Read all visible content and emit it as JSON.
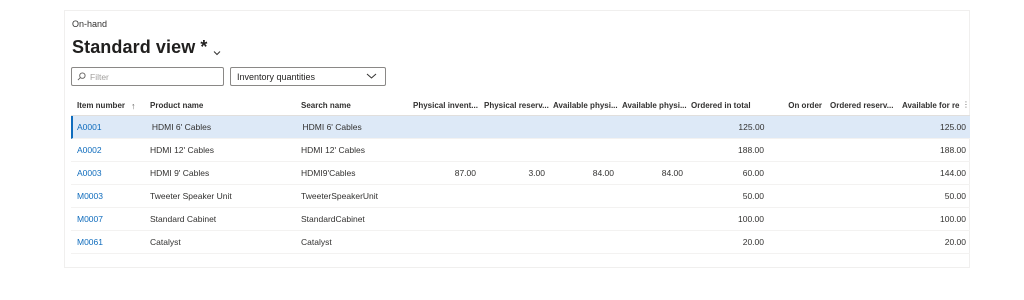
{
  "page": {
    "breadcrumb": "On-hand",
    "title": "Standard view *"
  },
  "toolbar": {
    "filter_placeholder": "Filter",
    "view_select": "Inventory quantities"
  },
  "grid": {
    "sort_glyph": "↑",
    "more_glyph": "⋮",
    "columns": [
      "Item number",
      "Product name",
      "Search name",
      "Physical invent...",
      "Physical reserv...",
      "Available physi...",
      "Available physi...",
      "Ordered in total",
      "On order",
      "Ordered reserv...",
      "Available for re"
    ],
    "rows": [
      {
        "item": "A0001",
        "product": "HDMI 6' Cables",
        "search": "HDMI 6' Cables",
        "phys_inv": "",
        "phys_res": "",
        "avail_phys1": "",
        "avail_phys2": "",
        "ordered_total": "125.00",
        "on_order": "",
        "ordered_res": "",
        "avail_res": "125.00",
        "selected": true
      },
      {
        "item": "A0002",
        "product": "HDMI 12' Cables",
        "search": "HDMI 12' Cables",
        "phys_inv": "",
        "phys_res": "",
        "avail_phys1": "",
        "avail_phys2": "",
        "ordered_total": "188.00",
        "on_order": "",
        "ordered_res": "",
        "avail_res": "188.00",
        "selected": false
      },
      {
        "item": "A0003",
        "product": "HDMI 9' Cables",
        "search": "HDMI9'Cables",
        "phys_inv": "87.00",
        "phys_res": "3.00",
        "avail_phys1": "84.00",
        "avail_phys2": "84.00",
        "ordered_total": "60.00",
        "on_order": "",
        "ordered_res": "",
        "avail_res": "144.00",
        "selected": false
      },
      {
        "item": "M0003",
        "product": "Tweeter Speaker Unit",
        "search": "TweeterSpeakerUnit",
        "phys_inv": "",
        "phys_res": "",
        "avail_phys1": "",
        "avail_phys2": "",
        "ordered_total": "50.00",
        "on_order": "",
        "ordered_res": "",
        "avail_res": "50.00",
        "selected": false
      },
      {
        "item": "M0007",
        "product": "Standard Cabinet",
        "search": "StandardCabinet",
        "phys_inv": "",
        "phys_res": "",
        "avail_phys1": "",
        "avail_phys2": "",
        "ordered_total": "100.00",
        "on_order": "",
        "ordered_res": "",
        "avail_res": "100.00",
        "selected": false
      },
      {
        "item": "M0061",
        "product": "Catalyst",
        "search": "Catalyst",
        "phys_inv": "",
        "phys_res": "",
        "avail_phys1": "",
        "avail_phys2": "",
        "ordered_total": "20.00",
        "on_order": "",
        "ordered_res": "",
        "avail_res": "20.00",
        "selected": false
      }
    ]
  },
  "colors": {
    "accent": "#0f6cbd",
    "selected_row": "#dde9f7",
    "text": "#201f1e"
  },
  "icons": {
    "filter": "search-icon",
    "title_menu": "chevron-down-icon",
    "select": "chevron-down-icon",
    "sort": "sort-ascending-icon",
    "more": "more-vertical-icon"
  }
}
